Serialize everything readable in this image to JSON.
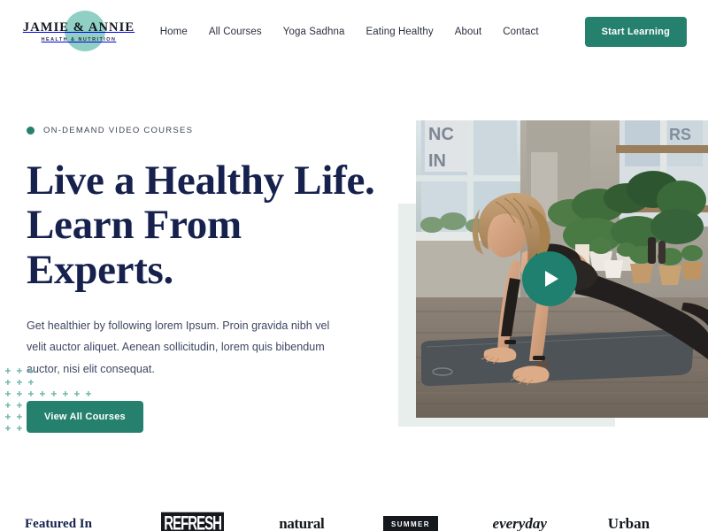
{
  "header": {
    "brand": {
      "name": "JAMIE & ANNIE",
      "tagline": "HEALTH & NUTRITION",
      "circle_color": "#8fcfc4"
    },
    "nav": [
      {
        "label": "Home"
      },
      {
        "label": "All Courses"
      },
      {
        "label": "Yoga Sadhna"
      },
      {
        "label": "Eating Healthy"
      },
      {
        "label": "About"
      },
      {
        "label": "Contact"
      }
    ],
    "cta_label": "Start Learning"
  },
  "hero": {
    "eyebrow": "ON-DEMAND VIDEO COURSES",
    "title": "Live a Healthy Life. Learn From Experts.",
    "description": "Get healthier by following lorem Ipsum. Proin gravida nibh vel velit auctor aliquet. Aenean sollicitudin, lorem quis bibendum auctor, nisi elit consequat.",
    "cta_label": "View All Courses",
    "play_label": "Play video",
    "media_alt": "Woman doing a yoga plank pose on a mat in a plant-filled studio"
  },
  "featured": {
    "label": "Featured In",
    "logos": [
      {
        "name": "REFRESH"
      },
      {
        "name": "natural"
      },
      {
        "name": "SUMMER"
      },
      {
        "name": "everyday"
      },
      {
        "name": "Urban"
      }
    ]
  },
  "colors": {
    "accent_teal": "#25806e",
    "brand_mint": "#8fcfc4",
    "panel_mint": "#e7eeec",
    "navy": "#16214d",
    "body_text": "#3e4763",
    "dot_grid": "#7cbcae"
  }
}
